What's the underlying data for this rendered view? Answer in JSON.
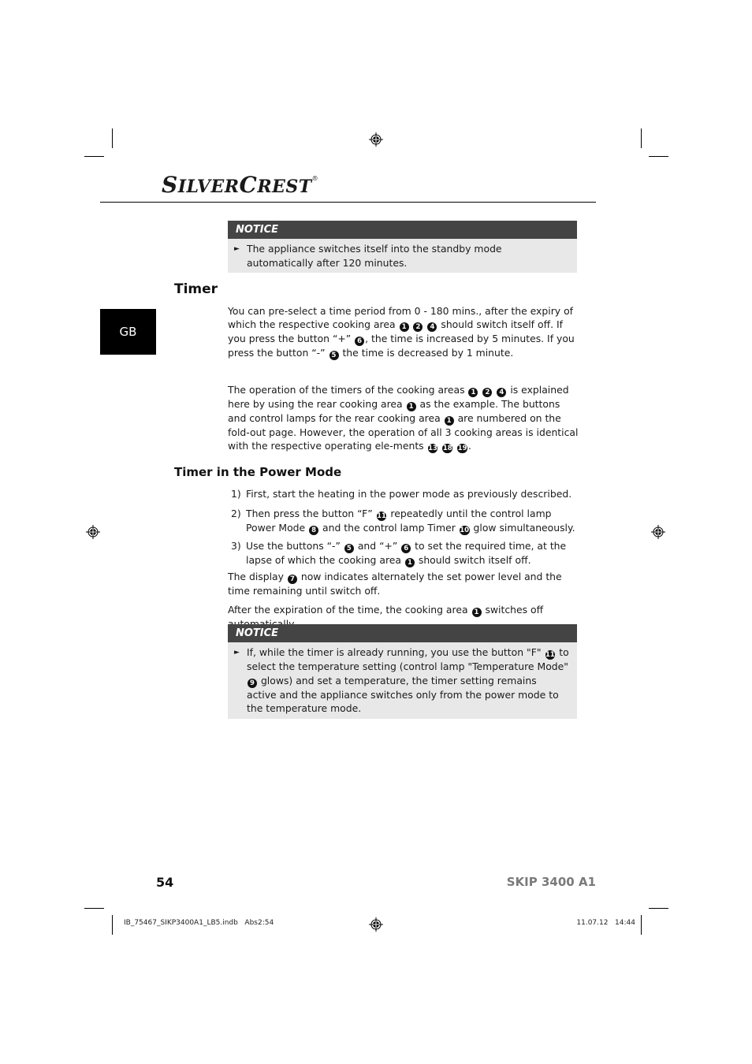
{
  "brand": {
    "logo_first_initial": "S",
    "logo_first_rest": "ILVER",
    "logo_second_initial": "C",
    "logo_second_rest": "REST",
    "registered": "®"
  },
  "language_tab": "GB",
  "notice_top": {
    "heading": "NOTICE",
    "bullet_icon": "arrow-right-icon",
    "text": "The appliance switches itself into the standby mode automatically after 120 minutes."
  },
  "section_timer": {
    "heading": "Timer",
    "paragraph1": {
      "segments": [
        "You can pre-select a time period from 0 - 180 mins., after the expiry of which the respective cooking area ",
        "1",
        " ",
        "2",
        " ",
        "4",
        " should switch itself off. If you press the button “+” ",
        "6",
        ", the time is increased by 5 minutes. If you press the button “-” ",
        "5",
        " the time is decreased by 1 minute."
      ]
    },
    "paragraph2": {
      "segments": [
        "The operation of the timers of the cooking areas ",
        "1",
        " ",
        "2",
        " ",
        "4",
        " is explained here by using the rear cooking area ",
        "1",
        " as the example. The buttons and control lamps for the rear cooking area ",
        "1",
        " are numbered on the fold-out page. However, the operation of all 3 cooking areas is identical with the respective operating ele-ments ",
        "13",
        " ",
        "18",
        " ",
        "19",
        "."
      ]
    }
  },
  "section_power_mode": {
    "heading": "Timer in the Power Mode",
    "steps": [
      {
        "num": "1)",
        "segments": [
          "First, start the heating in the power mode as previously described."
        ]
      },
      {
        "num": "2)",
        "segments": [
          "Then press the button “F” ",
          "11",
          " repeatedly until the control lamp Power Mode ",
          "8",
          " and the control lamp Timer ",
          "10",
          " glow simultaneously."
        ]
      },
      {
        "num": "3)",
        "segments": [
          "Use the buttons “-” ",
          "5",
          " and “+” ",
          "6",
          " to set the required time, at the lapse of which the cooking area ",
          "1",
          " should switch itself off."
        ]
      }
    ],
    "paragraph_display": {
      "segments": [
        "The display ",
        "7",
        " now indicates alternately the set power level and the time remaining until switch off."
      ]
    },
    "paragraph_expiry": {
      "segments": [
        "After the expiration of the time, the cooking area ",
        "1",
        " switches off automatically."
      ]
    }
  },
  "notice_bottom": {
    "heading": "NOTICE",
    "bullet_icon": "arrow-right-icon",
    "segments": [
      "If, while the timer is already running, you use the button \"F\" ",
      "11",
      " to select the temperature setting (control lamp \"Temperature Mode\" ",
      "9",
      " glows) and set a temperature, the timer setting remains active and the appliance switches only from the power mode to the temperature mode."
    ]
  },
  "footer": {
    "page_number": "54",
    "model": "SKIP 3400 A1",
    "slug_file": "IB_75467_SIKP3400A1_LB5.indb   Abs2:54",
    "slug_date": "11.07.12   14:44"
  }
}
